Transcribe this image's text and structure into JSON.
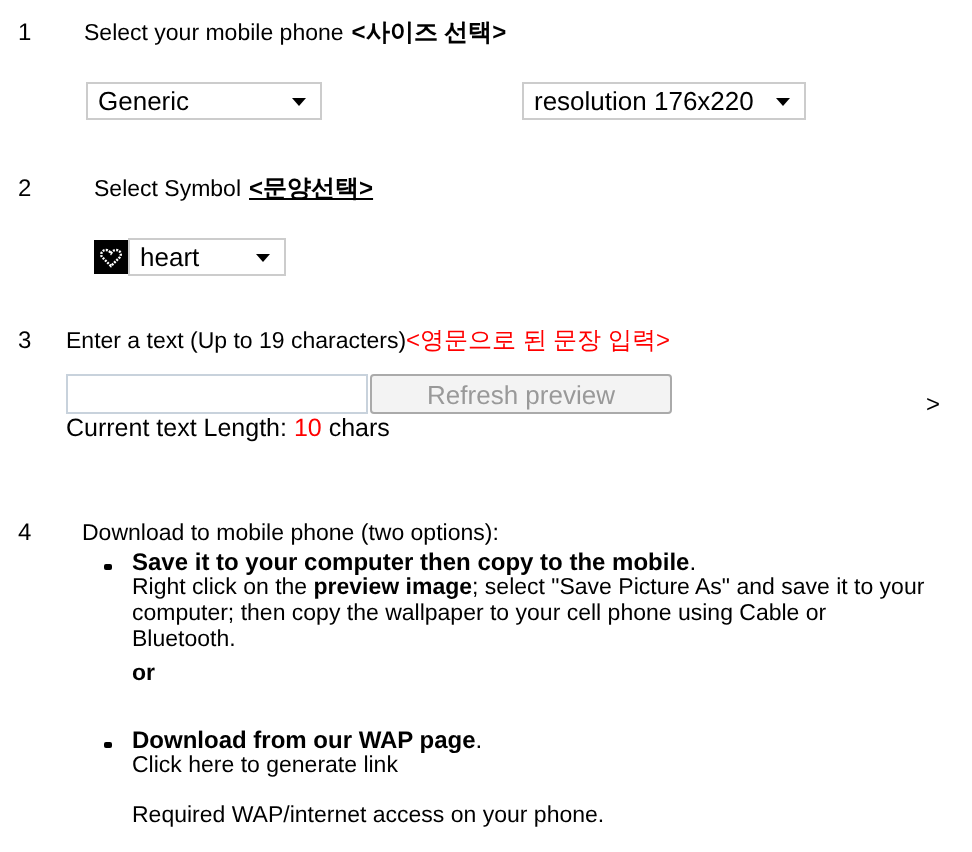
{
  "step1": {
    "number": "1",
    "label": "Select your mobile phone",
    "note": "<사이즈 선택>"
  },
  "phone_select": {
    "value": "Generic"
  },
  "resolution_select": {
    "value": "resolution 176x220"
  },
  "step2": {
    "number": "2",
    "label": "Select Symbol",
    "note": "<문양선택>"
  },
  "symbol_select": {
    "value": "heart"
  },
  "step3": {
    "number": "3",
    "label": "Enter a text (Up to 19 characters)",
    "note": "<영문으로 된 문장 입력>"
  },
  "refresh_button": {
    "label": "Refresh preview",
    "disabled": true
  },
  "length": {
    "label": "Current text Length:",
    "count": "10",
    "unit": "chars"
  },
  "side_arrow": ">",
  "step4": {
    "number": "4",
    "label": "Download to mobile phone (two options):"
  },
  "options": [
    {
      "title": "**Save it to your computer then copy to the mobile**.",
      "lines": [
        "Right click on the **preview image**; select \"Save Picture As\" and save it to your computer; then copy the wallpaper to your cell phone using Cable or Bluetooth."
      ],
      "after": "or"
    },
    {
      "title": "**Download from our WAP page**.",
      "lines": [
        "Click here to generate link",
        "Required WAP/internet access on your phone."
      ]
    }
  ]
}
